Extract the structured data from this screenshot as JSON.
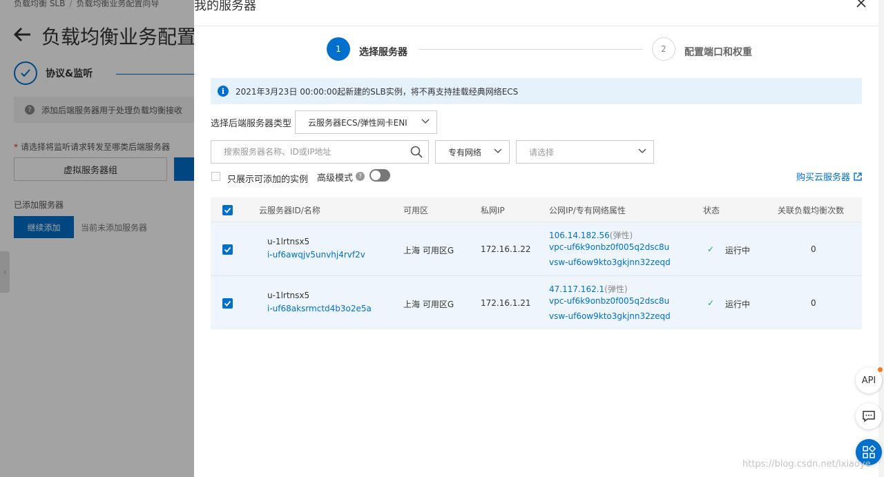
{
  "background": {
    "breadcrumb": [
      "负载均衡 SLB",
      "负载均衡业务配置向导"
    ],
    "breadcrumb_sep": "/",
    "title": "负载均衡业务配置",
    "step_label": "协议&监听",
    "notice": "添加后端服务器用于处理负载均衡接收",
    "required_label": "请选择将监听请求转发至哪类后端服务器",
    "virtual_group_button": "虚拟服务器组",
    "added_label": "已添加服务器",
    "continue_button": "继续添加",
    "none_added": "当前未添加服务器"
  },
  "drawer": {
    "title": "我的服务器",
    "steps": [
      {
        "number": "1",
        "label": "选择服务器"
      },
      {
        "number": "2",
        "label": "配置端口和权重"
      }
    ],
    "info": "2021年3月23日 00:00:00起新建的SLB实例，将不再支持挂载经典网络ECS",
    "type_label": "选择后端服务器类型",
    "type_value": "云服务器ECS/弹性网卡ENI",
    "search_placeholder": "搜索服务器名称、ID或IP地址",
    "network_value": "专有网络",
    "vpc_placeholder": "请选择",
    "only_addable_label": "只展示可添加的实例",
    "advanced_label": "高级模式",
    "advanced_help": "?",
    "buy_link": "购买云服务器"
  },
  "table": {
    "columns": [
      "云服务器ID/名称",
      "可用区",
      "私网IP",
      "公网IP/专有网络属性",
      "状态",
      "关联负载均衡次数"
    ],
    "rows": [
      {
        "name": "u-1lrtnsx5",
        "id": "i-uf6awqjv5unvhj4rvf2v",
        "zone": "上海 可用区G",
        "private_ip": "172.16.1.22",
        "public_ip": "106.14.182.56",
        "ip_tag": "(弹性)",
        "vpc": "vpc-uf6k9onbz0f005q2dsc8u",
        "vsw": "vsw-uf6ow9kto3gkjnn32zeqd",
        "status": "运行中",
        "lb_count": "0",
        "checked": true
      },
      {
        "name": "u-1lrtnsx5",
        "id": "i-uf68aksrmctd4b3o2e5a",
        "zone": "上海 可用区G",
        "private_ip": "172.16.1.21",
        "public_ip": "47.117.162.1",
        "ip_tag": "(弹性)",
        "vpc": "vpc-uf6k9onbz0f005q2dsc8u",
        "vsw": "vsw-uf6ow9kto3gkjnn32zeqd",
        "status": "运行中",
        "lb_count": "0",
        "checked": true
      }
    ]
  },
  "widgets": {
    "api_label": "API",
    "watermark": "https://blog.csdn.net/lxiaoye"
  },
  "colors": {
    "accent": "#0070cc",
    "info_bg": "#e6f2fb",
    "row_selected_bg": "#eef5fc",
    "status_green": "#2ea34a",
    "notification_dot": "#f37b1d"
  },
  "icons": [
    "close-icon",
    "check-icon",
    "info-icon",
    "chevron-down-icon",
    "search-icon",
    "external-link-icon",
    "help-icon",
    "chat-icon",
    "apps-icon",
    "back-arrow-icon"
  ]
}
